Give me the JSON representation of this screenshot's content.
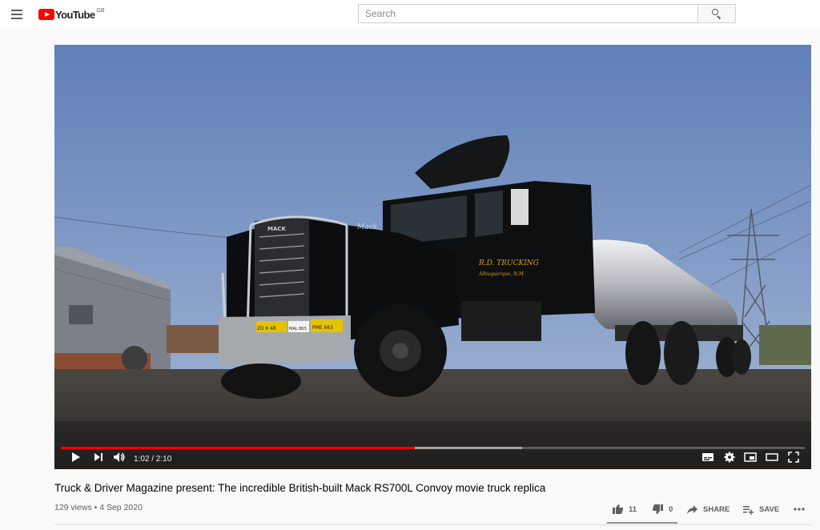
{
  "header": {
    "logo_text": "YouTube",
    "country_code": "GB",
    "search_placeholder": "Search",
    "menu_icon": "hamburger-menu-icon",
    "search_icon": "search-icon"
  },
  "player": {
    "current_time": "1:02",
    "duration": "2:10",
    "time_label": "1:02 / 2:10",
    "played_fraction": 0.476,
    "buffered_fraction": 0.62,
    "truck_door_text": "R.D. TRUCKING",
    "truck_door_subtext": "Albuquerque, N.M.",
    "truck_brand": "Mack",
    "grille_badge": "MACK",
    "plate_left": "2D 6 48",
    "plate_mid": "MAL 863",
    "plate_right": "PME 663"
  },
  "video": {
    "title": "Truck & Driver Magazine present: The incredible British-built Mack RS700L Convoy movie truck replica",
    "views": "129 views",
    "date": "4 Sep 2020",
    "meta_line": "129 views • 4 Sep 2020"
  },
  "actions": {
    "likes": "11",
    "dislikes": "0",
    "share_label": "SHARE",
    "save_label": "SAVE"
  },
  "colors": {
    "accent": "#ff0000",
    "sky": "#7e98c6",
    "text_primary": "#030303",
    "text_secondary": "#606060"
  }
}
